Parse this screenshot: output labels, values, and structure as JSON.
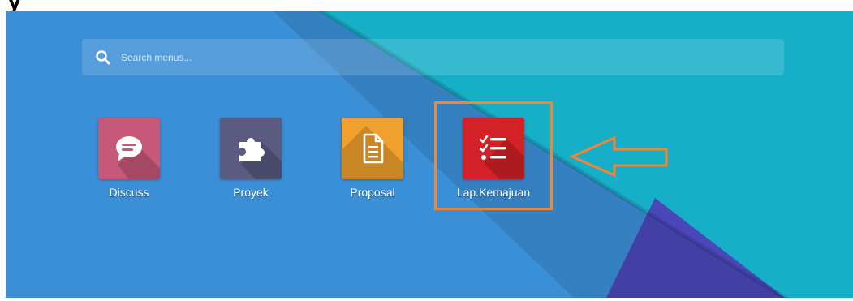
{
  "header": {
    "clipped_text": "y"
  },
  "search": {
    "placeholder": "Search menus..."
  },
  "apps": [
    {
      "label": "Discuss",
      "icon": "speech-bubble-icon",
      "color": "#c8587a"
    },
    {
      "label": "Proyek",
      "icon": "puzzle-icon",
      "color": "#5b5b82"
    },
    {
      "label": "Proposal",
      "icon": "document-icon",
      "color": "#f0a02c"
    },
    {
      "label": "Lap.Kemajuan",
      "icon": "checklist-icon",
      "color": "#d42127"
    }
  ],
  "annotation": {
    "color": "#f28633",
    "highlighted_app": "Lap.Kemajuan"
  },
  "colors": {
    "background_blue": "#3a8fd6",
    "background_teal": "#17aec7",
    "background_indigo": "#4a47b8"
  }
}
